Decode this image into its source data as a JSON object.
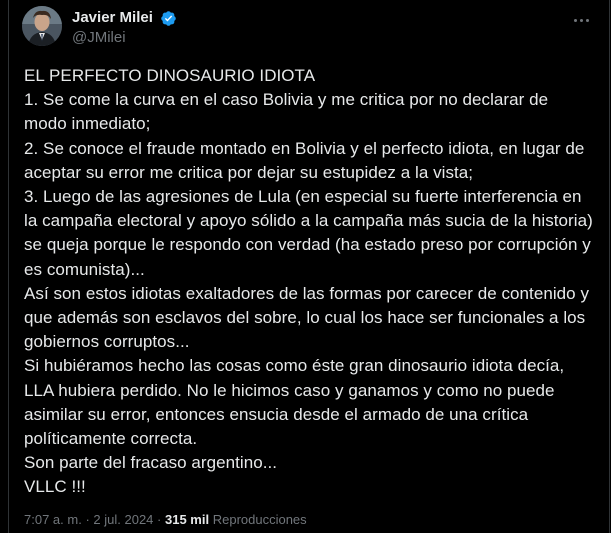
{
  "author": {
    "display_name": "Javier Milei",
    "handle": "@JMilei",
    "verified_color": "#1d9bf0"
  },
  "more_icon": "more-horizontal-icon",
  "tweet": {
    "text": "EL PERFECTO DINOSAURIO IDIOTA\n1. Se come la curva en el caso Bolivia y me critica por no declarar de modo inmediato;\n2. Se conoce el fraude montado en Bolivia y el perfecto idiota, en lugar de aceptar su error me critica por dejar su estupidez a la vista;\n3. Luego de las agresiones de Lula (en especial su fuerte interferencia en la campaña electoral y apoyo sólido a la campaña más sucia de la historia) se queja porque le respondo con verdad (ha estado preso por corrupción y es comunista)...\nAsí son estos idiotas exaltadores de las formas por carecer de contenido y que además son esclavos del sobre, lo cual los hace ser funcionales a los gobiernos corruptos...\nSi hubiéramos hecho las cosas como éste gran dinosaurio idiota decía, LLA hubiera perdido. No le hicimos caso y ganamos y como no puede asimilar su error, entonces ensucia desde el armado de una crítica políticamente correcta.\nSon parte del fracaso argentino...\nVLLC !!!"
  },
  "meta": {
    "time": "7:07 a. m.",
    "separator": "·",
    "date": "2 jul. 2024",
    "views_count": "315 mil",
    "views_label": "Reproducciones"
  }
}
